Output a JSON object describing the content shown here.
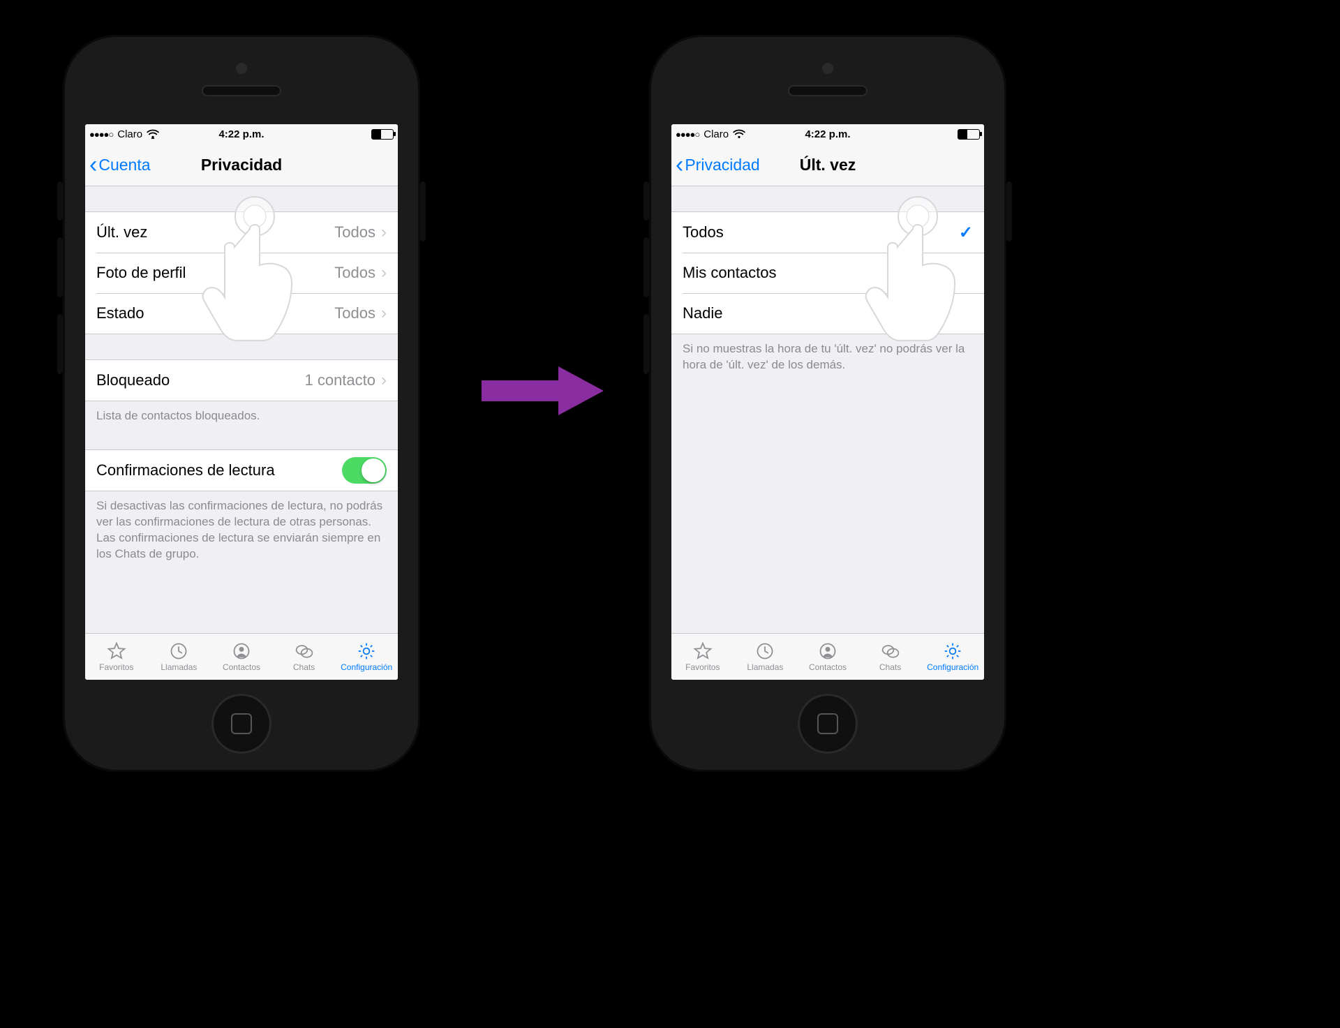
{
  "status": {
    "signal_dots": "●●●●○",
    "carrier": "Claro",
    "time": "4:22 p.m."
  },
  "tabs": {
    "favorites": "Favoritos",
    "calls": "Llamadas",
    "contacts": "Contactos",
    "chats": "Chats",
    "settings": "Configuración"
  },
  "left": {
    "nav_back": "Cuenta",
    "nav_title": "Privacidad",
    "rows": {
      "last_seen": {
        "label": "Últ. vez",
        "value": "Todos"
      },
      "photo": {
        "label": "Foto de perfil",
        "value": "Todos"
      },
      "status": {
        "label": "Estado",
        "value": "Todos"
      },
      "blocked": {
        "label": "Bloqueado",
        "value": "1 contacto"
      },
      "read": {
        "label": "Confirmaciones de lectura"
      }
    },
    "blocked_note": "Lista de contactos bloqueados.",
    "read_note": "Si desactivas las confirmaciones de lectura, no podrás ver las confirmaciones de lectura de otras personas. Las confirmaciones de lectura se enviarán siempre en los Chats de grupo."
  },
  "right": {
    "nav_back": "Privacidad",
    "nav_title": "Últ. vez",
    "options": {
      "everyone": "Todos",
      "contacts": "Mis contactos",
      "nobody": "Nadie"
    },
    "note": "Si no muestras la hora de tu 'últ. vez' no podrás ver la hora de 'últ. vez' de los demás."
  }
}
